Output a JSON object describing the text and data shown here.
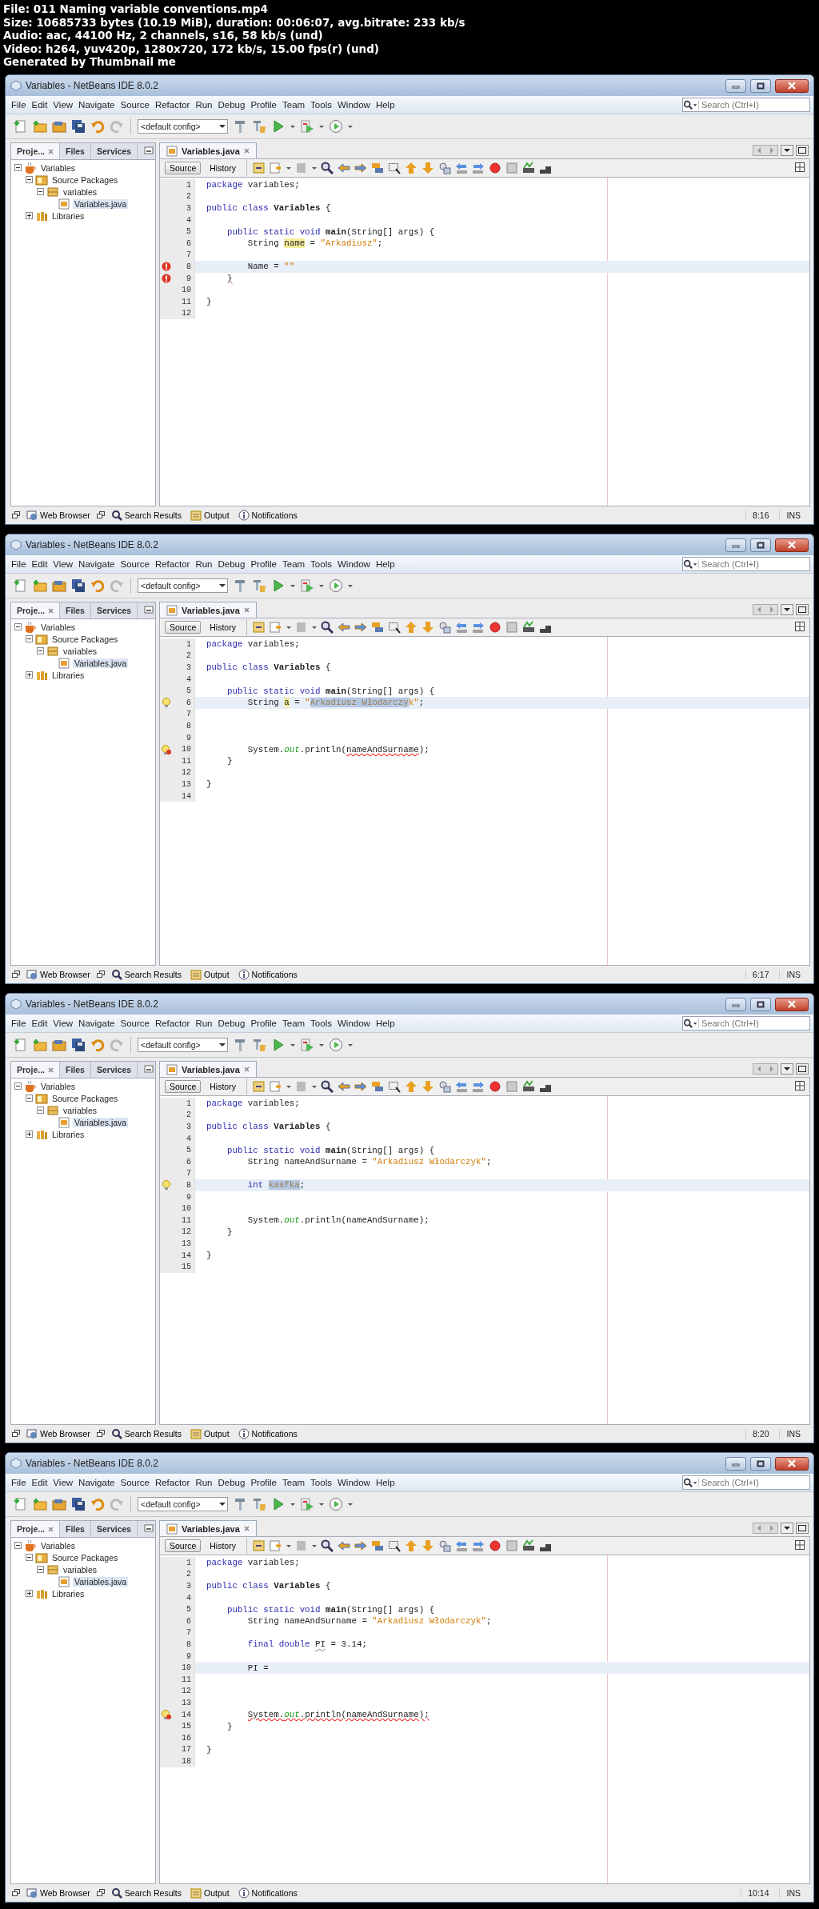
{
  "header": [
    "File: 011 Naming variable conventions.mp4",
    "Size: 10685733 bytes (10.19 MiB), duration: 00:06:07, avg.bitrate: 233 kb/s",
    "Audio: aac, 44100 Hz, 2 channels, s16, 58 kb/s (und)",
    "Video: h264, yuv420p, 1280x720, 172 kb/s, 15.00 fps(r) (und)",
    "Generated by Thumbnail me"
  ],
  "frames": [
    {
      "window": {
        "title": "Variables - NetBeans IDE 8.0.2"
      },
      "menu": [
        "File",
        "Edit",
        "View",
        "Navigate",
        "Source",
        "Refactor",
        "Run",
        "Debug",
        "Profile",
        "Team",
        "Tools",
        "Window",
        "Help"
      ],
      "search": {
        "placeholder": "Search (Ctrl+I)"
      },
      "config": "<default config>",
      "panel_tabs": [
        {
          "label": "Proje...",
          "selected": true
        },
        {
          "label": "Files",
          "selected": false
        },
        {
          "label": "Services",
          "selected": false
        }
      ],
      "tree": [
        {
          "label": "Variables",
          "kind": "project",
          "expanded": true,
          "selected": false,
          "children": [
            {
              "label": "Source Packages",
              "kind": "folder",
              "expanded": true,
              "selected": false,
              "children": [
                {
                  "label": "variables",
                  "kind": "package",
                  "expanded": true,
                  "selected": false,
                  "children": [
                    {
                      "label": "Variables.java",
                      "kind": "file",
                      "selected": true
                    }
                  ]
                }
              ]
            },
            {
              "label": "Libraries",
              "kind": "library",
              "expanded": false,
              "selected": false
            }
          ]
        }
      ],
      "editor_tab": "Variables.java",
      "view_tabs": [
        {
          "label": "Source",
          "selected": true
        },
        {
          "label": "History",
          "selected": false
        }
      ],
      "lines": [
        {
          "n": "1",
          "current": false,
          "tokens": [
            {
              "t": "package",
              "kind": "keyword"
            },
            {
              "t": " variables;",
              "kind": "plain"
            }
          ]
        },
        {
          "n": "2",
          "current": false
        },
        {
          "n": "3",
          "current": false,
          "tokens": [
            {
              "t": "public class",
              "kind": "keyword"
            },
            {
              "t": " Variables",
              "kind": "bold"
            },
            {
              "t": " {",
              "kind": "plain"
            }
          ]
        },
        {
          "n": "4",
          "current": false
        },
        {
          "n": "5",
          "current": false,
          "tokens": [
            {
              "t": "    public static void",
              "kind": "keyword"
            },
            {
              "t": " main",
              "kind": "bold"
            },
            {
              "t": "(String[] args) {",
              "kind": "plain"
            }
          ]
        },
        {
          "n": "6",
          "current": false,
          "tokens": [
            {
              "t": "        String ",
              "kind": "plain"
            },
            {
              "t": "name",
              "kind": "occurrence"
            },
            {
              "t": " = ",
              "kind": "plain"
            },
            {
              "t": "\"Arkadiusz\"",
              "kind": "string"
            },
            {
              "t": ";",
              "kind": "plain"
            }
          ]
        },
        {
          "n": "7",
          "current": false
        },
        {
          "n": "8",
          "current": true,
          "kind": "error",
          "tokens": [
            {
              "t": "        Name = ",
              "kind": "plain"
            },
            {
              "t": "\"\"",
              "kind": "string"
            }
          ]
        },
        {
          "n": "9",
          "current": false,
          "kind": "error",
          "tokens": [
            {
              "t": "    }",
              "kind": "error"
            }
          ]
        },
        {
          "n": "10",
          "current": false
        },
        {
          "n": "11",
          "current": false,
          "tokens": [
            {
              "t": "}",
              "kind": "plain"
            }
          ]
        },
        {
          "n": "12",
          "current": false
        }
      ],
      "bottom_tabs": [
        "Web Browser",
        "Search Results",
        "Output",
        "Notifications"
      ],
      "status": {
        "position": "8:16",
        "mode": "INS"
      }
    },
    {
      "window": {
        "title": "Variables - NetBeans IDE 8.0.2"
      },
      "menu": [
        "File",
        "Edit",
        "View",
        "Navigate",
        "Source",
        "Refactor",
        "Run",
        "Debug",
        "Profile",
        "Team",
        "Tools",
        "Window",
        "Help"
      ],
      "search": {
        "placeholder": "Search (Ctrl+I)"
      },
      "config": "<default config>",
      "panel_tabs": [
        {
          "label": "Proje...",
          "selected": true
        },
        {
          "label": "Files",
          "selected": false
        },
        {
          "label": "Services",
          "selected": false
        }
      ],
      "tree": [
        {
          "label": "Variables",
          "kind": "project",
          "expanded": true,
          "selected": false,
          "children": [
            {
              "label": "Source Packages",
              "kind": "folder",
              "expanded": true,
              "selected": false,
              "children": [
                {
                  "label": "variables",
                  "kind": "package",
                  "expanded": true,
                  "selected": false,
                  "children": [
                    {
                      "label": "Variables.java",
                      "kind": "file",
                      "selected": true
                    }
                  ]
                }
              ]
            },
            {
              "label": "Libraries",
              "kind": "library",
              "expanded": false,
              "selected": false
            }
          ]
        }
      ],
      "editor_tab": "Variables.java",
      "view_tabs": [
        {
          "label": "Source",
          "selected": true
        },
        {
          "label": "History",
          "selected": false
        }
      ],
      "lines": [
        {
          "n": "1",
          "current": false,
          "tokens": [
            {
              "t": "package",
              "kind": "keyword"
            },
            {
              "t": " variables;",
              "kind": "plain"
            }
          ]
        },
        {
          "n": "2",
          "current": false
        },
        {
          "n": "3",
          "current": false,
          "tokens": [
            {
              "t": "public class",
              "kind": "keyword"
            },
            {
              "t": " Variables",
              "kind": "bold"
            },
            {
              "t": " {",
              "kind": "plain"
            }
          ]
        },
        {
          "n": "4",
          "current": false
        },
        {
          "n": "5",
          "current": false,
          "tokens": [
            {
              "t": "    public static void",
              "kind": "keyword"
            },
            {
              "t": " main",
              "kind": "bold"
            },
            {
              "t": "(String[] args) {",
              "kind": "plain"
            }
          ]
        },
        {
          "n": "6",
          "current": true,
          "kind": "hint",
          "tokens": [
            {
              "t": "        String ",
              "kind": "plain"
            },
            {
              "t": "a",
              "kind": "occurrence"
            },
            {
              "t": " = ",
              "kind": "plain"
            },
            {
              "t": "\"",
              "kind": "string"
            },
            {
              "t": "Arkadiusz Włodarczy",
              "kind": "selection"
            },
            {
              "t": "k\"",
              "kind": "string"
            },
            {
              "t": ";",
              "kind": "plain"
            }
          ]
        },
        {
          "n": "7",
          "current": false
        },
        {
          "n": "8",
          "current": false
        },
        {
          "n": "9",
          "current": false
        },
        {
          "n": "10",
          "current": false,
          "kind": "hint-error",
          "tokens": [
            {
              "t": "        System.",
              "kind": "plain"
            },
            {
              "t": "out",
              "kind": "field"
            },
            {
              "t": ".println(",
              "kind": "plain"
            },
            {
              "t": "nameAndSurname",
              "kind": "error"
            },
            {
              "t": ");",
              "kind": "plain"
            }
          ]
        },
        {
          "n": "11",
          "current": false,
          "tokens": [
            {
              "t": "    }",
              "kind": "plain"
            }
          ]
        },
        {
          "n": "12",
          "current": false
        },
        {
          "n": "13",
          "current": false,
          "tokens": [
            {
              "t": "}",
              "kind": "plain"
            }
          ]
        },
        {
          "n": "14",
          "current": false
        }
      ],
      "bottom_tabs": [
        "Web Browser",
        "Search Results",
        "Output",
        "Notifications"
      ],
      "status": {
        "position": "6:17",
        "mode": "INS"
      }
    },
    {
      "window": {
        "title": "Variables - NetBeans IDE 8.0.2"
      },
      "menu": [
        "File",
        "Edit",
        "View",
        "Navigate",
        "Source",
        "Refactor",
        "Run",
        "Debug",
        "Profile",
        "Team",
        "Tools",
        "Window",
        "Help"
      ],
      "search": {
        "placeholder": "Search (Ctrl+I)"
      },
      "config": "<default config>",
      "panel_tabs": [
        {
          "label": "Proje...",
          "selected": true
        },
        {
          "label": "Files",
          "selected": false
        },
        {
          "label": "Services",
          "selected": false
        }
      ],
      "tree": [
        {
          "label": "Variables",
          "kind": "project",
          "expanded": true,
          "selected": false,
          "children": [
            {
              "label": "Source Packages",
              "kind": "folder",
              "expanded": true,
              "selected": false,
              "children": [
                {
                  "label": "variables",
                  "kind": "package",
                  "expanded": true,
                  "selected": false,
                  "children": [
                    {
                      "label": "Variables.java",
                      "kind": "file",
                      "selected": true
                    }
                  ]
                }
              ]
            },
            {
              "label": "Libraries",
              "kind": "library",
              "expanded": false,
              "selected": false
            }
          ]
        }
      ],
      "editor_tab": "Variables.java",
      "view_tabs": [
        {
          "label": "Source",
          "selected": true
        },
        {
          "label": "History",
          "selected": false
        }
      ],
      "lines": [
        {
          "n": "1",
          "current": false,
          "tokens": [
            {
              "t": "package",
              "kind": "keyword"
            },
            {
              "t": " variables;",
              "kind": "plain"
            }
          ]
        },
        {
          "n": "2",
          "current": false
        },
        {
          "n": "3",
          "current": false,
          "tokens": [
            {
              "t": "public class",
              "kind": "keyword"
            },
            {
              "t": " Variables",
              "kind": "bold"
            },
            {
              "t": " {",
              "kind": "plain"
            }
          ]
        },
        {
          "n": "4",
          "current": false
        },
        {
          "n": "5",
          "current": false,
          "tokens": [
            {
              "t": "    public static void",
              "kind": "keyword"
            },
            {
              "t": " main",
              "kind": "bold"
            },
            {
              "t": "(String[] args) {",
              "kind": "plain"
            }
          ]
        },
        {
          "n": "6",
          "current": false,
          "tokens": [
            {
              "t": "        String nameAndSurname = ",
              "kind": "plain"
            },
            {
              "t": "\"Arkadiusz Włodarczyk\"",
              "kind": "string"
            },
            {
              "t": ";",
              "kind": "plain"
            }
          ]
        },
        {
          "n": "7",
          "current": false
        },
        {
          "n": "8",
          "current": true,
          "kind": "hint",
          "tokens": [
            {
              "t": "        int",
              "kind": "keyword"
            },
            {
              "t": " kasfka",
              "kind": "selection"
            },
            {
              "t": ";",
              "kind": "plain"
            }
          ]
        },
        {
          "n": "9",
          "current": false
        },
        {
          "n": "10",
          "current": false
        },
        {
          "n": "11",
          "current": false,
          "tokens": [
            {
              "t": "        System.",
              "kind": "plain"
            },
            {
              "t": "out",
              "kind": "field"
            },
            {
              "t": ".println(nameAndSurname);",
              "kind": "plain"
            }
          ]
        },
        {
          "n": "12",
          "current": false,
          "tokens": [
            {
              "t": "    }",
              "kind": "plain"
            }
          ]
        },
        {
          "n": "13",
          "current": false
        },
        {
          "n": "14",
          "current": false,
          "tokens": [
            {
              "t": "}",
              "kind": "plain"
            }
          ]
        },
        {
          "n": "15",
          "current": false
        }
      ],
      "bottom_tabs": [
        "Web Browser",
        "Search Results",
        "Output",
        "Notifications"
      ],
      "status": {
        "position": "8:20",
        "mode": "INS"
      }
    },
    {
      "window": {
        "title": "Variables - NetBeans IDE 8.0.2"
      },
      "menu": [
        "File",
        "Edit",
        "View",
        "Navigate",
        "Source",
        "Refactor",
        "Run",
        "Debug",
        "Profile",
        "Team",
        "Tools",
        "Window",
        "Help"
      ],
      "search": {
        "placeholder": "Search (Ctrl+I)"
      },
      "config": "<default config>",
      "panel_tabs": [
        {
          "label": "Proje...",
          "selected": true
        },
        {
          "label": "Files",
          "selected": false
        },
        {
          "label": "Services",
          "selected": false
        }
      ],
      "tree": [
        {
          "label": "Variables",
          "kind": "project",
          "expanded": true,
          "selected": false,
          "children": [
            {
              "label": "Source Packages",
              "kind": "folder",
              "expanded": true,
              "selected": false,
              "children": [
                {
                  "label": "variables",
                  "kind": "package",
                  "expanded": true,
                  "selected": false,
                  "children": [
                    {
                      "label": "Variables.java",
                      "kind": "file",
                      "selected": true
                    }
                  ]
                }
              ]
            },
            {
              "label": "Libraries",
              "kind": "library",
              "expanded": false,
              "selected": false
            }
          ]
        }
      ],
      "editor_tab": "Variables.java",
      "view_tabs": [
        {
          "label": "Source",
          "selected": true
        },
        {
          "label": "History",
          "selected": false
        }
      ],
      "lines": [
        {
          "n": "1",
          "current": false,
          "tokens": [
            {
              "t": "package",
              "kind": "keyword"
            },
            {
              "t": " variables;",
              "kind": "plain"
            }
          ]
        },
        {
          "n": "2",
          "current": false
        },
        {
          "n": "3",
          "current": false,
          "tokens": [
            {
              "t": "public class",
              "kind": "keyword"
            },
            {
              "t": " Variables",
              "kind": "bold"
            },
            {
              "t": " {",
              "kind": "plain"
            }
          ]
        },
        {
          "n": "4",
          "current": false
        },
        {
          "n": "5",
          "current": false,
          "tokens": [
            {
              "t": "    public static void",
              "kind": "keyword"
            },
            {
              "t": " main",
              "kind": "bold"
            },
            {
              "t": "(String[] args) {",
              "kind": "plain"
            }
          ]
        },
        {
          "n": "6",
          "current": false,
          "tokens": [
            {
              "t": "        String nameAndSurname = ",
              "kind": "plain"
            },
            {
              "t": "\"Arkadiusz Włodarczyk\"",
              "kind": "string"
            },
            {
              "t": ";",
              "kind": "plain"
            }
          ]
        },
        {
          "n": "7",
          "current": false
        },
        {
          "n": "8",
          "current": false,
          "tokens": [
            {
              "t": "        final double",
              "kind": "keyword"
            },
            {
              "t": " PI",
              "kind": "warning"
            },
            {
              "t": " = 3.14;",
              "kind": "plain"
            }
          ]
        },
        {
          "n": "9",
          "current": false
        },
        {
          "n": "10",
          "current": true,
          "tokens": [
            {
              "t": "        PI =",
              "kind": "plain"
            }
          ]
        },
        {
          "n": "11",
          "current": false
        },
        {
          "n": "12",
          "current": false
        },
        {
          "n": "13",
          "current": false
        },
        {
          "n": "14",
          "current": false,
          "kind": "hint-error",
          "tokens": [
            {
              "t": "        System.",
              "kind": "error"
            },
            {
              "t": "out",
              "kind": "field-error"
            },
            {
              "t": ".println(nameAndSurname);",
              "kind": "error"
            }
          ]
        },
        {
          "n": "15",
          "current": false,
          "tokens": [
            {
              "t": "    }",
              "kind": "plain"
            }
          ]
        },
        {
          "n": "16",
          "current": false
        },
        {
          "n": "17",
          "current": false,
          "tokens": [
            {
              "t": "}",
              "kind": "plain"
            }
          ]
        },
        {
          "n": "18",
          "current": false
        }
      ],
      "bottom_tabs": [
        "Web Browser",
        "Search Results",
        "Output",
        "Notifications"
      ],
      "status": {
        "position": "10:14",
        "mode": "INS"
      }
    }
  ]
}
